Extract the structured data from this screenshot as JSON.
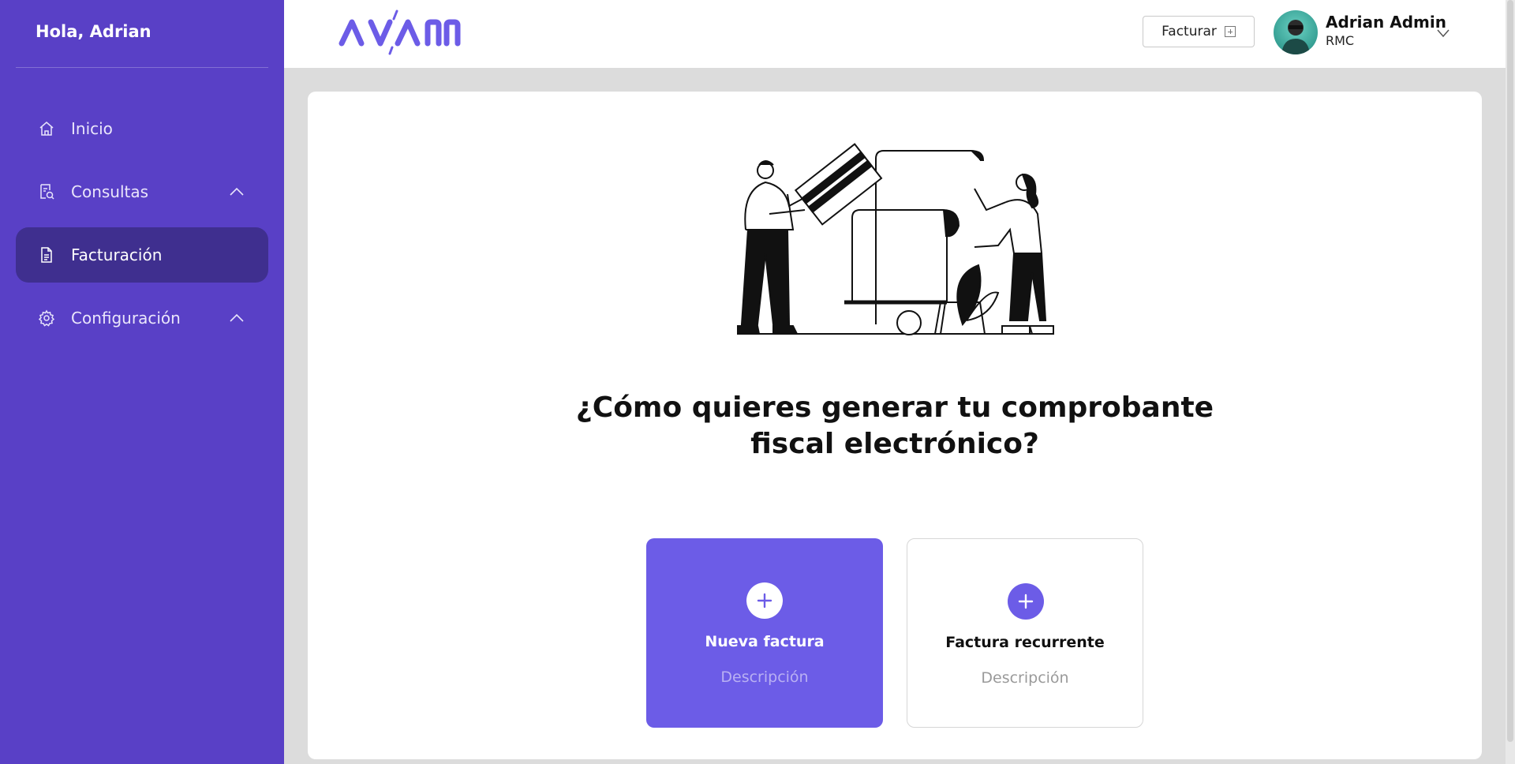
{
  "sidebar": {
    "greeting": "Hola, Adrian",
    "items": [
      {
        "label": "Inicio",
        "icon": "home-icon"
      },
      {
        "label": "Consultas",
        "icon": "document-search-icon"
      },
      {
        "label": "Facturación",
        "icon": "document-icon",
        "active": true
      },
      {
        "label": "Configuración",
        "icon": "gear-icon"
      }
    ]
  },
  "header": {
    "logo_text": "AVAN",
    "facturar_label": "Facturar",
    "user": {
      "name": "Adrian Admin",
      "org": "RMC"
    }
  },
  "main": {
    "question_line1": "¿Cómo quieres generar tu comprobante",
    "question_line2": "fiscal electrónico?",
    "options": [
      {
        "title": "Nueva factura",
        "description": "Descripción"
      },
      {
        "title": "Factura recurrente",
        "description": "Descripción"
      }
    ]
  },
  "colors": {
    "sidebar_bg": "#5940c6",
    "sidebar_active": "#3f2f8f",
    "accent": "#6c5ce7",
    "page_bg": "#dcdcdc"
  }
}
